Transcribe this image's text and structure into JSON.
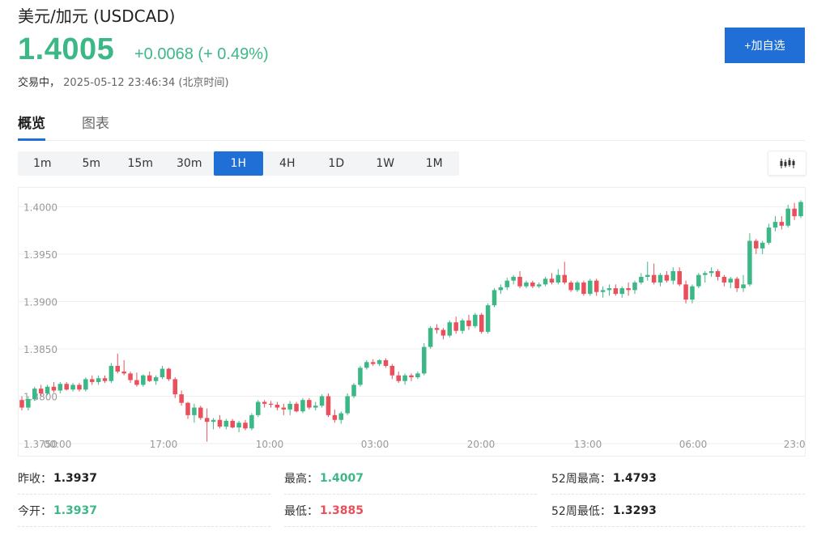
{
  "header": {
    "title": "美元/加元  (USDCAD)",
    "price": "1.4005",
    "change": "+0.0068 (+ 0.49%)",
    "status_label": "交易中，",
    "timestamp": "2025-05-12 23:46:34",
    "timezone": "(北京时间)",
    "add_button": "+加自选"
  },
  "tabs": [
    {
      "label": "概览",
      "active": true
    },
    {
      "label": "图表",
      "active": false
    }
  ],
  "intervals": [
    {
      "label": "1m",
      "active": false
    },
    {
      "label": "5m",
      "active": false
    },
    {
      "label": "15m",
      "active": false
    },
    {
      "label": "30m",
      "active": false
    },
    {
      "label": "1H",
      "active": true
    },
    {
      "label": "4H",
      "active": false
    },
    {
      "label": "1D",
      "active": false
    },
    {
      "label": "1W",
      "active": false
    },
    {
      "label": "1M",
      "active": false
    }
  ],
  "chart_type_icon": "candlestick-icon",
  "colors": {
    "up": "#3cb887",
    "down": "#e9505b",
    "accent": "#1f6fd6"
  },
  "stats": {
    "prev_close": {
      "label": "昨收：",
      "value": "1.3937"
    },
    "high": {
      "label": "最高：",
      "value": "1.4007"
    },
    "high52": {
      "label": "52周最高：",
      "value": "1.4793"
    },
    "open": {
      "label": "今开：",
      "value": "1.3937"
    },
    "low": {
      "label": "最低：",
      "value": "1.3885"
    },
    "low52": {
      "label": "52周最低：",
      "value": "1.3293"
    }
  },
  "chart_data": {
    "type": "candlestick",
    "ylim": [
      1.375,
      1.402
    ],
    "y_ticks": [
      "1.4000",
      "1.3950",
      "1.3900",
      "1.3850",
      "1.3800",
      "1.3750"
    ],
    "x_ticks": [
      "00:00",
      "17:00",
      "10:00",
      "03:00",
      "20:00",
      "13:00",
      "06:00",
      "23:00"
    ],
    "grid": true,
    "ohlc": [
      [
        1.3796,
        1.38,
        1.3785,
        1.3788
      ],
      [
        1.3788,
        1.38,
        1.3785,
        1.3797
      ],
      [
        1.3797,
        1.381,
        1.3795,
        1.3808
      ],
      [
        1.3808,
        1.3812,
        1.38,
        1.3803
      ],
      [
        1.3803,
        1.3812,
        1.3801,
        1.381
      ],
      [
        1.381,
        1.3815,
        1.3804,
        1.3806
      ],
      [
        1.3806,
        1.3815,
        1.3803,
        1.3813
      ],
      [
        1.3813,
        1.3815,
        1.3806,
        1.3807
      ],
      [
        1.3807,
        1.3814,
        1.3805,
        1.3812
      ],
      [
        1.3812,
        1.3814,
        1.3805,
        1.3807
      ],
      [
        1.3807,
        1.382,
        1.3805,
        1.3818
      ],
      [
        1.3818,
        1.3822,
        1.3812,
        1.3815
      ],
      [
        1.3815,
        1.3822,
        1.3812,
        1.3819
      ],
      [
        1.3819,
        1.3822,
        1.3814,
        1.3816
      ],
      [
        1.3816,
        1.3835,
        1.3814,
        1.3832
      ],
      [
        1.3832,
        1.3845,
        1.3824,
        1.3826
      ],
      [
        1.3826,
        1.3838,
        1.3822,
        1.3824
      ],
      [
        1.3824,
        1.3826,
        1.3814,
        1.3817
      ],
      [
        1.3817,
        1.3825,
        1.381,
        1.3812
      ],
      [
        1.3812,
        1.3823,
        1.381,
        1.3822
      ],
      [
        1.3822,
        1.3826,
        1.3815,
        1.3816
      ],
      [
        1.3816,
        1.3822,
        1.3812,
        1.382
      ],
      [
        1.382,
        1.3832,
        1.3818,
        1.3829
      ],
      [
        1.3829,
        1.383,
        1.3816,
        1.3818
      ],
      [
        1.3818,
        1.382,
        1.3798,
        1.3802
      ],
      [
        1.3802,
        1.3806,
        1.379,
        1.3793
      ],
      [
        1.3793,
        1.3794,
        1.3776,
        1.378
      ],
      [
        1.378,
        1.3792,
        1.3772,
        1.3788
      ],
      [
        1.3788,
        1.379,
        1.3775,
        1.3777
      ],
      [
        1.3777,
        1.3787,
        1.3752,
        1.3773
      ],
      [
        1.3773,
        1.3777,
        1.3765,
        1.3775
      ],
      [
        1.3775,
        1.378,
        1.3766,
        1.3768
      ],
      [
        1.3768,
        1.3776,
        1.3765,
        1.3774
      ],
      [
        1.3774,
        1.3776,
        1.3766,
        1.3767
      ],
      [
        1.3767,
        1.3774,
        1.3762,
        1.3772
      ],
      [
        1.3772,
        1.3775,
        1.3764,
        1.3766
      ],
      [
        1.3766,
        1.3782,
        1.3764,
        1.378
      ],
      [
        1.378,
        1.3796,
        1.3778,
        1.3794
      ],
      [
        1.3794,
        1.3796,
        1.3788,
        1.3792
      ],
      [
        1.3792,
        1.3795,
        1.3788,
        1.3791
      ],
      [
        1.3791,
        1.3794,
        1.3785,
        1.3788
      ],
      [
        1.3788,
        1.3792,
        1.378,
        1.3786
      ],
      [
        1.3786,
        1.3795,
        1.378,
        1.3792
      ],
      [
        1.3792,
        1.3794,
        1.3783,
        1.3784
      ],
      [
        1.3784,
        1.3798,
        1.3782,
        1.3796
      ],
      [
        1.3796,
        1.3798,
        1.3786,
        1.3788
      ],
      [
        1.3788,
        1.3794,
        1.3785,
        1.379
      ],
      [
        1.379,
        1.3802,
        1.3788,
        1.38
      ],
      [
        1.38,
        1.3803,
        1.3778,
        1.378
      ],
      [
        1.378,
        1.3786,
        1.3772,
        1.3775
      ],
      [
        1.3775,
        1.3784,
        1.3771,
        1.3782
      ],
      [
        1.3782,
        1.3803,
        1.378,
        1.38
      ],
      [
        1.38,
        1.3814,
        1.3798,
        1.3812
      ],
      [
        1.3812,
        1.3832,
        1.381,
        1.383
      ],
      [
        1.383,
        1.3838,
        1.3828,
        1.3836
      ],
      [
        1.3836,
        1.3839,
        1.3832,
        1.3834
      ],
      [
        1.3834,
        1.3839,
        1.3832,
        1.3838
      ],
      [
        1.3838,
        1.384,
        1.383,
        1.3832
      ],
      [
        1.3832,
        1.3834,
        1.3818,
        1.3822
      ],
      [
        1.3822,
        1.3826,
        1.3814,
        1.3816
      ],
      [
        1.3816,
        1.3824,
        1.3812,
        1.3822
      ],
      [
        1.3822,
        1.3824,
        1.3816,
        1.382
      ],
      [
        1.382,
        1.3826,
        1.3818,
        1.3824
      ],
      [
        1.3824,
        1.3856,
        1.3822,
        1.3852
      ],
      [
        1.3852,
        1.3874,
        1.385,
        1.3872
      ],
      [
        1.3872,
        1.3876,
        1.3866,
        1.387
      ],
      [
        1.387,
        1.3872,
        1.386,
        1.3864
      ],
      [
        1.3864,
        1.388,
        1.3862,
        1.3878
      ],
      [
        1.3878,
        1.3884,
        1.3866,
        1.3869
      ],
      [
        1.3869,
        1.3882,
        1.3866,
        1.388
      ],
      [
        1.388,
        1.3886,
        1.387,
        1.3874
      ],
      [
        1.3874,
        1.3888,
        1.3872,
        1.3886
      ],
      [
        1.3886,
        1.3888,
        1.3866,
        1.3868
      ],
      [
        1.3868,
        1.3898,
        1.3866,
        1.3896
      ],
      [
        1.3896,
        1.3914,
        1.3894,
        1.3912
      ],
      [
        1.3912,
        1.3918,
        1.3908,
        1.3915
      ],
      [
        1.3915,
        1.3925,
        1.3912,
        1.3922
      ],
      [
        1.3922,
        1.3928,
        1.3918,
        1.3926
      ],
      [
        1.3926,
        1.3932,
        1.3914,
        1.3916
      ],
      [
        1.3916,
        1.3922,
        1.3914,
        1.392
      ],
      [
        1.392,
        1.3922,
        1.3914,
        1.3916
      ],
      [
        1.3916,
        1.392,
        1.3914,
        1.3918
      ],
      [
        1.3918,
        1.3926,
        1.3916,
        1.3924
      ],
      [
        1.3924,
        1.393,
        1.3918,
        1.392
      ],
      [
        1.392,
        1.3934,
        1.3918,
        1.3928
      ],
      [
        1.3928,
        1.3942,
        1.3918,
        1.392
      ],
      [
        1.392,
        1.3922,
        1.391,
        1.3912
      ],
      [
        1.3912,
        1.3922,
        1.391,
        1.392
      ],
      [
        1.392,
        1.3922,
        1.3906,
        1.3908
      ],
      [
        1.3908,
        1.3924,
        1.3906,
        1.3922
      ],
      [
        1.3922,
        1.3924,
        1.3906,
        1.391
      ],
      [
        1.391,
        1.3916,
        1.3904,
        1.3912
      ],
      [
        1.3912,
        1.3918,
        1.3906,
        1.3914
      ],
      [
        1.3914,
        1.3918,
        1.3906,
        1.3908
      ],
      [
        1.3908,
        1.3916,
        1.3904,
        1.3914
      ],
      [
        1.3914,
        1.392,
        1.3906,
        1.3912
      ],
      [
        1.3912,
        1.3922,
        1.3908,
        1.392
      ],
      [
        1.392,
        1.393,
        1.3918,
        1.3926
      ],
      [
        1.3926,
        1.3942,
        1.3922,
        1.3928
      ],
      [
        1.3928,
        1.394,
        1.3918,
        1.392
      ],
      [
        1.392,
        1.393,
        1.3916,
        1.3928
      ],
      [
        1.3928,
        1.3932,
        1.392,
        1.3922
      ],
      [
        1.3922,
        1.3936,
        1.3918,
        1.3932
      ],
      [
        1.3932,
        1.3936,
        1.3916,
        1.3918
      ],
      [
        1.3918,
        1.3922,
        1.3898,
        1.3902
      ],
      [
        1.3902,
        1.3918,
        1.3898,
        1.3916
      ],
      [
        1.3916,
        1.393,
        1.3914,
        1.3928
      ],
      [
        1.3928,
        1.3932,
        1.392,
        1.393
      ],
      [
        1.393,
        1.3936,
        1.3926,
        1.3932
      ],
      [
        1.3932,
        1.3934,
        1.3922,
        1.3926
      ],
      [
        1.3926,
        1.3928,
        1.3916,
        1.392
      ],
      [
        1.392,
        1.3926,
        1.3914,
        1.3924
      ],
      [
        1.3924,
        1.3926,
        1.391,
        1.3914
      ],
      [
        1.3914,
        1.3928,
        1.391,
        1.3918
      ],
      [
        1.3918,
        1.3972,
        1.3916,
        1.3964
      ],
      [
        1.3964,
        1.3966,
        1.395,
        1.3956
      ],
      [
        1.3956,
        1.3964,
        1.395,
        1.3962
      ],
      [
        1.3962,
        1.3982,
        1.396,
        1.3978
      ],
      [
        1.3978,
        1.399,
        1.3974,
        1.3984
      ],
      [
        1.3984,
        1.399,
        1.3976,
        1.398
      ],
      [
        1.398,
        1.4002,
        1.3978,
        1.3998
      ],
      [
        1.3998,
        1.4004,
        1.3986,
        1.399
      ],
      [
        1.399,
        1.4007,
        1.3988,
        1.4005
      ]
    ]
  }
}
